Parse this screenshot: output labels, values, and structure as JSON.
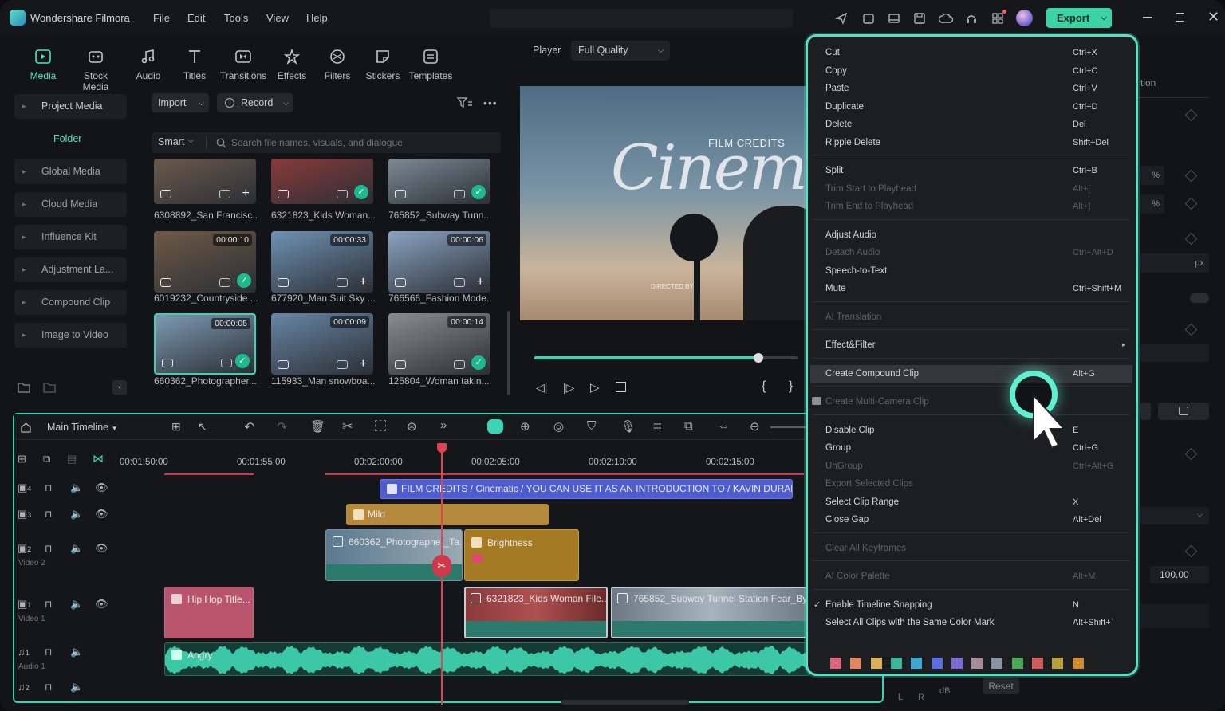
{
  "app": {
    "title": "Wondershare Filmora",
    "menus": [
      "File",
      "Edit",
      "Tools",
      "View",
      "Help"
    ],
    "export_label": "Export"
  },
  "modules": [
    {
      "label": "Media",
      "icon": "media-icon",
      "active": true
    },
    {
      "label": "Stock Media",
      "icon": "stock-media-icon"
    },
    {
      "label": "Audio",
      "icon": "music-note-icon"
    },
    {
      "label": "Titles",
      "icon": "text-t-icon"
    },
    {
      "label": "Transitions",
      "icon": "transitions-icon"
    },
    {
      "label": "Effects",
      "icon": "effects-icon"
    },
    {
      "label": "Filters",
      "icon": "filters-icon"
    },
    {
      "label": "Stickers",
      "icon": "stickers-icon"
    },
    {
      "label": "Templates",
      "icon": "templates-icon"
    }
  ],
  "sidebar": {
    "project_media": "Project Media",
    "folder": "Folder",
    "items": [
      "Global Media",
      "Cloud Media",
      "Influence Kit",
      "Adjustment La...",
      "Compound Clip",
      "Image to Video"
    ]
  },
  "media": {
    "import_label": "Import",
    "record_label": "Record",
    "smart_label": "Smart",
    "search_placeholder": "Search file names, visuals, and dialogue",
    "items": [
      {
        "name": "6308892_San Francisc...",
        "duration": "",
        "checked": false,
        "color": "#6b5a4b"
      },
      {
        "name": "6321823_Kids Woman...",
        "duration": "",
        "checked": true,
        "color": "#8a3a3a"
      },
      {
        "name": "765852_Subway Tunn...",
        "duration": "",
        "checked": true,
        "color": "#7d8a94"
      },
      {
        "name": "6019232_Countryside ...",
        "duration": "00:00:10",
        "checked": true,
        "color": "#6d5a45"
      },
      {
        "name": "677920_Man Suit Sky ...",
        "duration": "00:00:33",
        "checked": false,
        "color": "#6f92b4"
      },
      {
        "name": "766566_Fashion Mode...",
        "duration": "00:00:06",
        "checked": false,
        "color": "#8aa4c2"
      },
      {
        "name": "660362_Photographer...",
        "duration": "00:00:05",
        "checked": true,
        "color": "#7d9ab4"
      },
      {
        "name": "115933_Man snowboa...",
        "duration": "00:00:09",
        "checked": false,
        "color": "#6786a6"
      },
      {
        "name": "125804_Woman takin...",
        "duration": "00:00:14",
        "checked": true,
        "color": "#8a8d8f"
      }
    ]
  },
  "player": {
    "label": "Player",
    "quality": "Full Quality",
    "film_credits": "FILM CREDITS",
    "cinema": "Cinema",
    "directed_by": "DIRECTED BY",
    "progress": 0.85
  },
  "timeline": {
    "title": "Main Timeline",
    "timecodes": [
      "00:01:50:00",
      "00:01:55:00",
      "00:02:00:00",
      "00:02:05:00",
      "00:02:10:00",
      "00:02:15:00"
    ],
    "tracks": [
      {
        "num": "4",
        "sub": ""
      },
      {
        "num": "3",
        "sub": ""
      },
      {
        "num": "2",
        "sub": "Video 2"
      },
      {
        "num": "1",
        "sub": "Video 1"
      },
      {
        "num": "1",
        "sub": "Audio 1"
      },
      {
        "num": "2",
        "sub": ""
      }
    ],
    "clips": {
      "title": "FILM CREDITS / Cinematic / YOU CAN USE IT AS AN INTRODUCTION TO / KAVIN DURAN...",
      "mild": "Mild",
      "photographer": "660362_Photographer_Ta...",
      "brightness": "Brightness",
      "hiphop": "Hip Hop Title...",
      "kids": "6321823_Kids Woman File...",
      "subway": "765852_Subway Tunnel Station Fear_By_...",
      "angry": "Angry"
    }
  },
  "right_panel": {
    "reset": "Reset",
    "db": "dB",
    "l": "L",
    "r": "R",
    "value": "100.00",
    "px": "px",
    "pct": "%",
    "tion": "tion"
  },
  "context_menu": {
    "groups": [
      [
        {
          "label": "Cut",
          "shortcut": "Ctrl+X"
        },
        {
          "label": "Copy",
          "shortcut": "Ctrl+C"
        },
        {
          "label": "Paste",
          "shortcut": "Ctrl+V"
        },
        {
          "label": "Duplicate",
          "shortcut": "Ctrl+D"
        },
        {
          "label": "Delete",
          "shortcut": "Del"
        },
        {
          "label": "Ripple Delete",
          "shortcut": "Shift+Del"
        }
      ],
      [
        {
          "label": "Split",
          "shortcut": "Ctrl+B"
        },
        {
          "label": "Trim Start to Playhead",
          "shortcut": "Alt+[",
          "disabled": true
        },
        {
          "label": "Trim End to Playhead",
          "shortcut": "Alt+]",
          "disabled": true
        }
      ],
      [
        {
          "label": "Adjust Audio",
          "shortcut": ""
        },
        {
          "label": "Detach Audio",
          "shortcut": "Ctrl+Alt+D",
          "disabled": true
        },
        {
          "label": "Speech-to-Text",
          "shortcut": ""
        },
        {
          "label": "Mute",
          "shortcut": "Ctrl+Shift+M"
        }
      ],
      [
        {
          "label": "AI Translation",
          "shortcut": "",
          "disabled": true
        }
      ],
      [
        {
          "label": "Effect&Filter",
          "shortcut": "",
          "submenu": true
        }
      ],
      [
        {
          "label": "Create Compound Clip",
          "shortcut": "Alt+G",
          "highlighted": true
        }
      ],
      [
        {
          "label": "Create Multi-Camera Clip",
          "shortcut": "",
          "disabled": true
        }
      ],
      [
        {
          "label": "Disable Clip",
          "shortcut": "E"
        },
        {
          "label": "Group",
          "shortcut": "Ctrl+G"
        },
        {
          "label": "UnGroup",
          "shortcut": "Ctrl+Alt+G",
          "disabled": true
        },
        {
          "label": "Export Selected Clips",
          "shortcut": "",
          "disabled": true
        },
        {
          "label": "Select Clip Range",
          "shortcut": "X"
        },
        {
          "label": "Close Gap",
          "shortcut": "Alt+Del"
        }
      ],
      [
        {
          "label": "Clear All Keyframes",
          "shortcut": "",
          "disabled": true
        }
      ],
      [
        {
          "label": "AI Color Palette",
          "shortcut": "Alt+M",
          "disabled": true
        }
      ],
      [
        {
          "label": "Enable Timeline Snapping",
          "shortcut": "N",
          "checked": true
        },
        {
          "label": "Select All Clips with the Same Color Mark",
          "shortcut": "Alt+Shift+`"
        }
      ]
    ],
    "color_marks": [
      "#d9667a",
      "#e08660",
      "#d9b25b",
      "#3fb59b",
      "#39a9d0",
      "#5d6fe0",
      "#8068d6",
      "#a88b9a",
      "#8b94a3",
      "#48a85a",
      "#d25b5b",
      "#b8a13a",
      "#cf8b2c"
    ]
  }
}
